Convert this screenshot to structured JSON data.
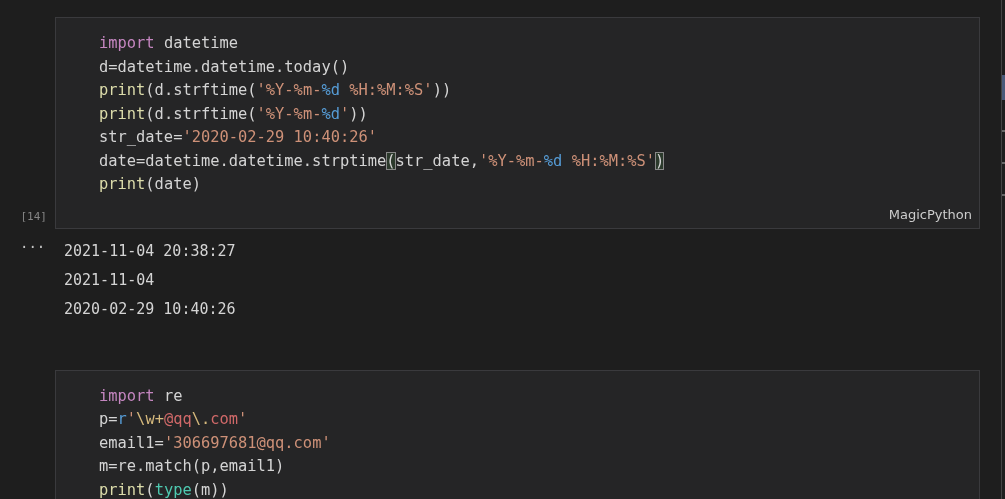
{
  "cells": [
    {
      "execution_count": "[14]",
      "language": "MagicPython",
      "lines": [
        [
          {
            "kind": "keyword",
            "text": "import"
          },
          {
            "kind": "plain",
            "text": " datetime"
          }
        ],
        [
          {
            "kind": "plain",
            "text": "d=datetime.datetime.today()"
          }
        ],
        [
          {
            "kind": "function",
            "text": "print"
          },
          {
            "kind": "plain",
            "text": "(d.strftime("
          },
          {
            "kind": "string",
            "text": "'%Y-%m-"
          },
          {
            "kind": "format",
            "text": "%d"
          },
          {
            "kind": "string",
            "text": " %H:%M:%S'"
          },
          {
            "kind": "plain",
            "text": "))"
          }
        ],
        [
          {
            "kind": "function",
            "text": "print"
          },
          {
            "kind": "plain",
            "text": "(d.strftime("
          },
          {
            "kind": "string",
            "text": "'%Y-%m-"
          },
          {
            "kind": "format",
            "text": "%d"
          },
          {
            "kind": "string",
            "text": "'"
          },
          {
            "kind": "plain",
            "text": "))"
          }
        ],
        [
          {
            "kind": "plain",
            "text": "str_date="
          },
          {
            "kind": "string",
            "text": "'2020-02-29 10:40:26'"
          }
        ],
        [
          {
            "kind": "plain",
            "text": "date=datetime.datetime.strptime"
          },
          {
            "kind": "bracket",
            "text": "("
          },
          {
            "kind": "plain",
            "text": "str_date,"
          },
          {
            "kind": "string",
            "text": "'%Y-%m-"
          },
          {
            "kind": "format",
            "text": "%d"
          },
          {
            "kind": "string",
            "text": " %H:%M:%S'"
          },
          {
            "kind": "bracket",
            "text": ")"
          }
        ],
        [
          {
            "kind": "function",
            "text": "print"
          },
          {
            "kind": "plain",
            "text": "(date)"
          }
        ]
      ],
      "output": {
        "menu": "···",
        "lines": [
          "2021-11-04 20:38:27",
          "2021-11-04",
          "2020-02-29 10:40:26"
        ]
      }
    },
    {
      "lines": [
        [
          {
            "kind": "keyword",
            "text": "import"
          },
          {
            "kind": "plain",
            "text": " re"
          }
        ],
        [
          {
            "kind": "plain",
            "text": "p="
          },
          {
            "kind": "prefix",
            "text": "r"
          },
          {
            "kind": "string",
            "text": "'"
          },
          {
            "kind": "regex_escape",
            "text": "\\w+"
          },
          {
            "kind": "regex",
            "text": "@qq"
          },
          {
            "kind": "regex_escape",
            "text": "\\."
          },
          {
            "kind": "regex",
            "text": "com"
          },
          {
            "kind": "string",
            "text": "'"
          }
        ],
        [
          {
            "kind": "plain",
            "text": "email1="
          },
          {
            "kind": "string",
            "text": "'306697681@qq.com'"
          }
        ],
        [
          {
            "kind": "plain",
            "text": "m=re.match(p,email1)"
          }
        ],
        [
          {
            "kind": "function",
            "text": "print"
          },
          {
            "kind": "plain",
            "text": "("
          },
          {
            "kind": "type",
            "text": "type"
          },
          {
            "kind": "plain",
            "text": "(m))"
          }
        ]
      ]
    }
  ]
}
